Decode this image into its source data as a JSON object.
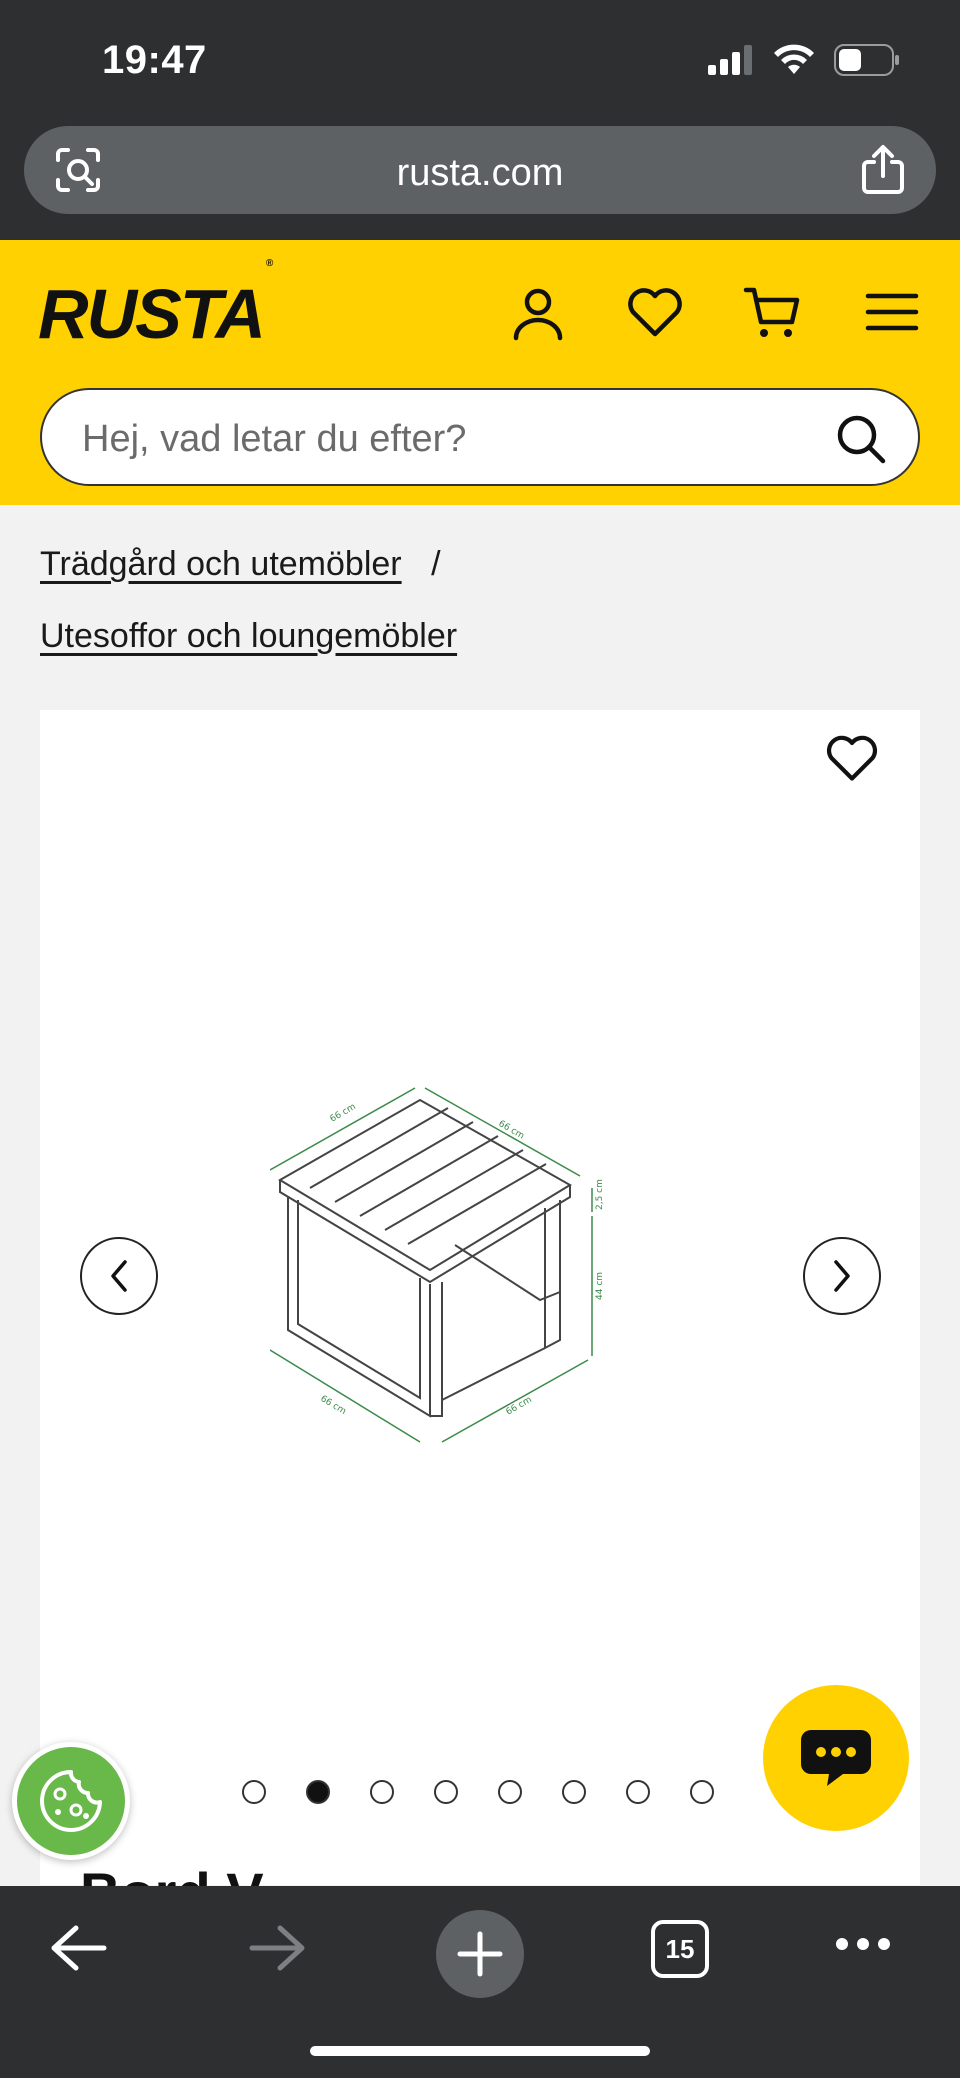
{
  "status": {
    "time": "19:47"
  },
  "browser": {
    "url": "rusta.com",
    "tab_count": "15"
  },
  "header": {
    "logo": "RUSTA",
    "logo_mark": "®",
    "search_placeholder": "Hej, vad letar du efter?"
  },
  "breadcrumbs": {
    "items": [
      "Trädgård och utemöbler",
      "Utesoffor och loungemöbler"
    ],
    "separator": "/"
  },
  "product": {
    "image_dimension_labels": [
      "66 cm",
      "66 cm",
      "66 cm",
      "66 cm",
      "2,5 cm",
      "44 cm"
    ],
    "carousel": {
      "total": 8,
      "active_index": 1
    },
    "peek_title": "Bord V"
  },
  "colors": {
    "brand_yellow": "#ffd100",
    "chrome_dark": "#2d2f31",
    "cookie_green": "#69b84a"
  },
  "icons": {
    "header": [
      "user-icon",
      "heart-icon",
      "cart-icon",
      "menu-icon"
    ],
    "bottom": [
      "back-arrow-icon",
      "forward-arrow-icon",
      "plus-icon",
      "tabs-icon",
      "more-icon"
    ]
  }
}
